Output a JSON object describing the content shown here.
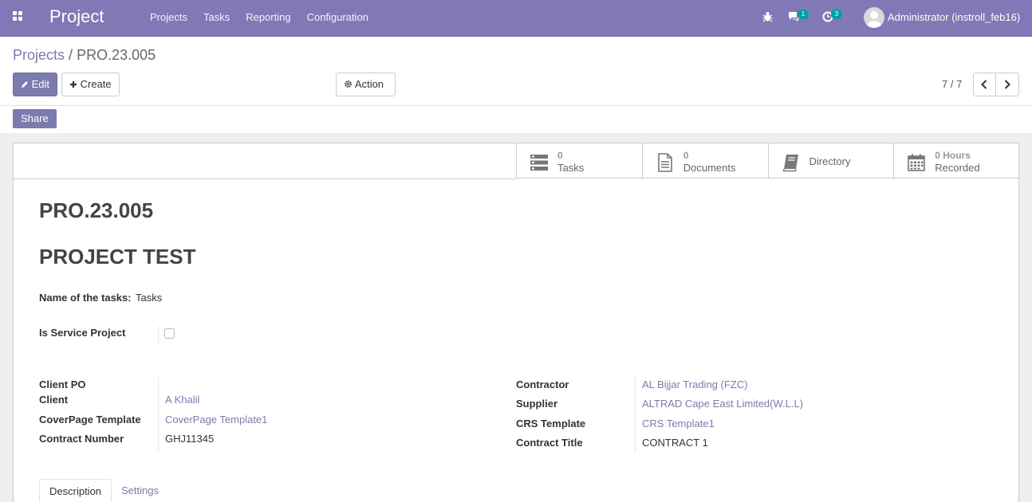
{
  "navbar": {
    "app_title": "Project",
    "menu": [
      "Projects",
      "Tasks",
      "Reporting",
      "Configuration"
    ],
    "messages_count": "1",
    "activities_count": "3",
    "user": "Administrator (instroll_feb16)"
  },
  "breadcrumb": {
    "parent": "Projects",
    "separator": "/",
    "current": "PRO.23.005"
  },
  "buttons": {
    "edit": "Edit",
    "create": "Create",
    "action": "Action",
    "share": "Share"
  },
  "pager": "7 / 7",
  "smart_buttons": [
    {
      "value": "0",
      "label": "Tasks",
      "icon": "tasks-icon"
    },
    {
      "value": "0",
      "label": "Documents",
      "icon": "document-icon"
    },
    {
      "value": "",
      "label": "Directory",
      "icon": "book-icon"
    },
    {
      "value": "0 Hours",
      "label": "Recorded",
      "icon": "calendar-icon"
    }
  ],
  "record": {
    "reference": "PRO.23.005",
    "name": "PROJECT TEST",
    "task_name_label": "Name of the tasks:",
    "task_name_value": "Tasks",
    "service_label": "Is Service Project",
    "service_value": false
  },
  "left_fields": [
    {
      "label": "Client PO",
      "value": "",
      "link": false
    },
    {
      "label": "Client",
      "value": "A Khalil",
      "link": true
    },
    {
      "label": "CoverPage Template",
      "value": "CoverPage Template1",
      "link": true
    },
    {
      "label": "Contract Number",
      "value": "GHJ11345",
      "link": false
    }
  ],
  "right_fields": [
    {
      "label": "Contractor",
      "value": "AL Bijjar Trading (FZC)",
      "link": true
    },
    {
      "label": "Supplier",
      "value": "ALTRAD Cape East Limited(W.L.L)",
      "link": true
    },
    {
      "label": "CRS Template",
      "value": "CRS Template1",
      "link": true
    },
    {
      "label": "Contract Title",
      "value": "CONTRACT 1",
      "link": false
    }
  ],
  "tabs": [
    "Description",
    "Settings"
  ],
  "colors": {
    "navbar": "#8179b5",
    "primary": "#7c7bad",
    "badge": "#00a09d"
  }
}
